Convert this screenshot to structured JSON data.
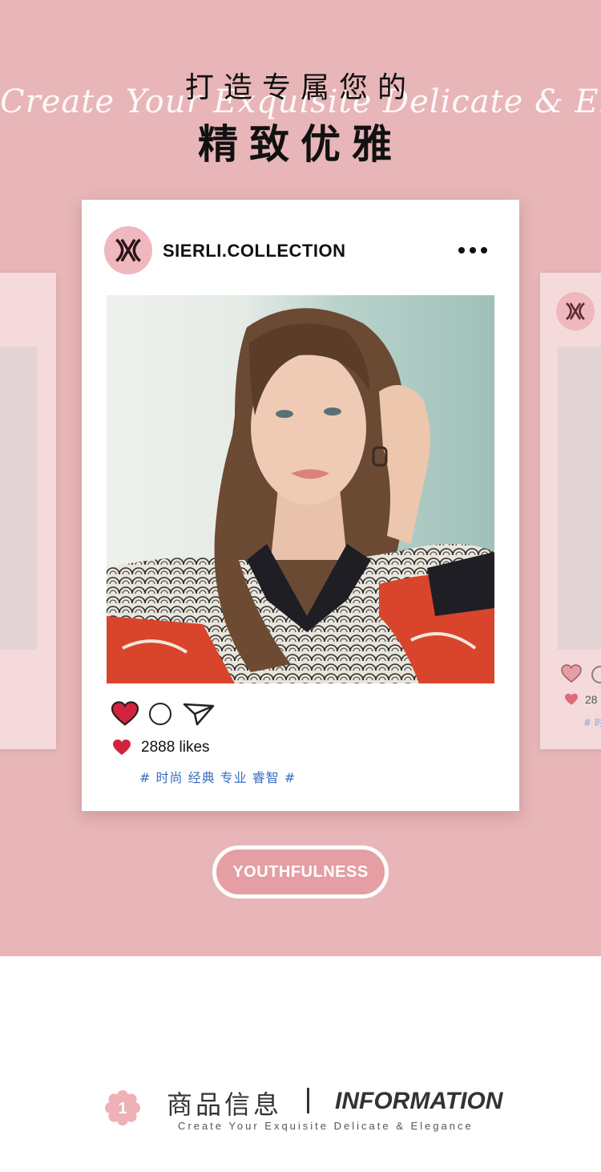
{
  "header": {
    "title_line1": "打造专属您的",
    "script_text": "Create Your Exquisite Delicate & Elegance",
    "title_line2": "精致优雅"
  },
  "post": {
    "account_name": "SIERLI.COLLECTION",
    "more_icon": "more-dots-icon",
    "likes_text": "2888 likes",
    "tags": "# 时尚 经典 专业 睿智 #"
  },
  "side_preview": {
    "likes_text": "28",
    "tag_text": "# 时"
  },
  "badge": {
    "label": "YOUTHFULNESS"
  },
  "info": {
    "number": "1",
    "title_cn": "商品信息",
    "title_en": "INFORMATION",
    "subtitle": "Create Your Exquisite Delicate & Elegance"
  },
  "colors": {
    "hero_bg": "#e8b6b8",
    "accent_pink": "#efb7be",
    "heart_red": "#d1233f",
    "tag_blue": "#3a6dbf"
  }
}
